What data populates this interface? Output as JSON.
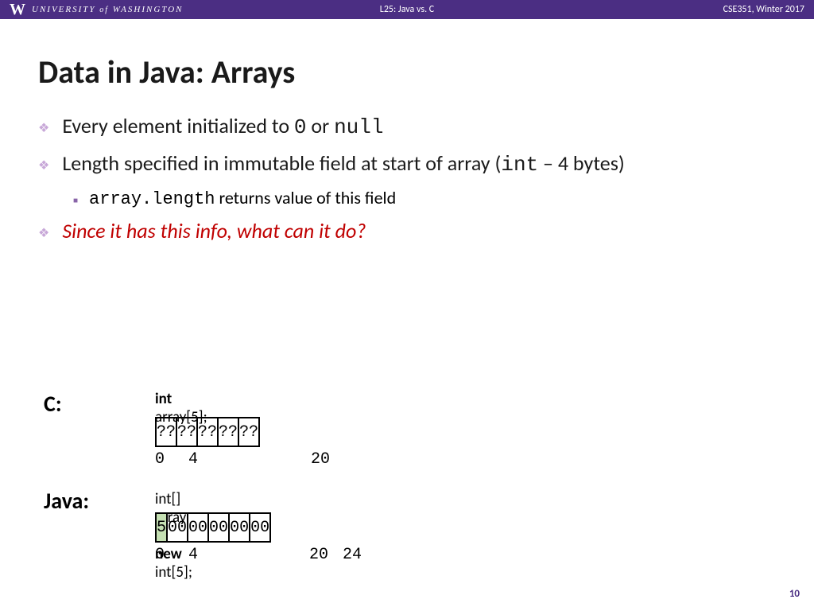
{
  "header": {
    "university": "UNIVERSITY of WASHINGTON",
    "lecture": "L25:  Java vs.  C",
    "course": "CSE351, Winter 2017"
  },
  "title": "Data in Java:  Arrays",
  "bullets": {
    "b1_pre": "Every element initialized to ",
    "b1_code1": "0",
    "b1_mid": " or ",
    "b1_code2": "null",
    "b2_pre": "Length specified in immutable field at start of array (",
    "b2_code": "int",
    "b2_post": " – 4 bytes)",
    "b2_sub_code": "array.length",
    "b2_sub_text": " returns value of this field",
    "b3": "Since it has this info, what can it do?"
  },
  "diagram": {
    "c_label": "C:",
    "java_label": "Java:",
    "c_decl_pre": "int",
    "c_decl_post": " array[5];",
    "java_decl_pre": "int[] array = ",
    "java_decl_new": "new",
    "java_decl_post": " int[5];",
    "c_cells": [
      "??",
      "??",
      "??",
      "??",
      "??"
    ],
    "java_len_cell": "5",
    "java_cells": [
      "00",
      "00",
      "00",
      "00",
      "00"
    ],
    "c_offsets": {
      "o0": "0",
      "o4": "4",
      "o20": "20"
    },
    "java_offsets": {
      "o0": "0",
      "o4": "4",
      "o20": "20",
      "o24": "24"
    }
  },
  "page_number": "10"
}
